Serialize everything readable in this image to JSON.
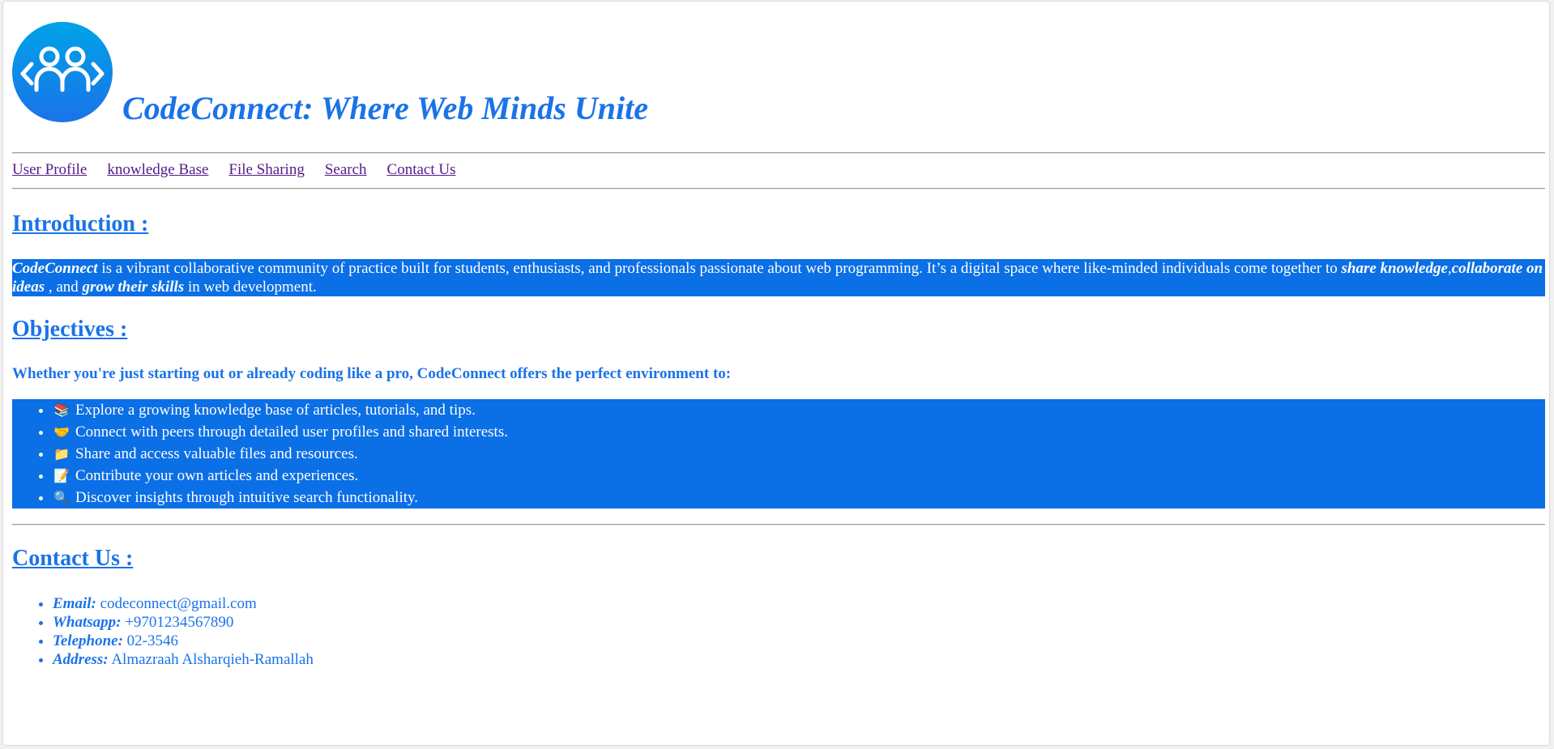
{
  "header": {
    "logo_icon": "people-collaboration-icon",
    "title": "CodeConnect: Where Web Minds Unite"
  },
  "nav": {
    "items": [
      {
        "label": "User Profile"
      },
      {
        "label": "knowledge Base"
      },
      {
        "label": "File Sharing"
      },
      {
        "label": "Search"
      },
      {
        "label": "Contact Us"
      }
    ]
  },
  "introduction": {
    "heading": "Introduction :",
    "brand": "CodeConnect",
    "text_1": " is a vibrant collaborative community of practice built for students, enthusiasts, and professionals passionate about web programming. It’s a digital space where like-minded individuals come together to ",
    "emph_1": "share knowledge",
    "sep_1": ",",
    "emph_2": "collaborate on ideas",
    "text_2": " , and ",
    "emph_3": "grow their skills",
    "text_3": " in web development."
  },
  "objectives": {
    "heading": "Objectives :",
    "lead": "Whether you're just starting out or already coding like a pro, CodeConnect offers the perfect environment to:",
    "items": [
      {
        "icon": "books-icon",
        "emoji": "📚",
        "text": "Explore a growing knowledge base of articles, tutorials, and tips."
      },
      {
        "icon": "handshake-icon",
        "emoji": "🤝",
        "text": "Connect with peers through detailed user profiles and shared interests."
      },
      {
        "icon": "folder-icon",
        "emoji": "📁",
        "text": "Share and access valuable files and resources."
      },
      {
        "icon": "memo-icon",
        "emoji": "📝",
        "text": "Contribute your own articles and experiences."
      },
      {
        "icon": "magnifier-icon",
        "emoji": "🔍",
        "text": "Discover insights through intuitive search functionality."
      }
    ]
  },
  "contact": {
    "heading": "Contact Us :",
    "items": [
      {
        "label": "Email:",
        "value": " codeconnect@gmail.com"
      },
      {
        "label": "Whatsapp:",
        "value": " +9701234567890"
      },
      {
        "label": "Telephone:",
        "value": " 02-3546"
      },
      {
        "label": "Address:",
        "value": " Almazraah Alsharqieh-Ramallah"
      }
    ]
  },
  "colors": {
    "accent": "#1a73e8",
    "highlight_bg": "#0b6fe6",
    "visited_link": "#551a8b"
  }
}
